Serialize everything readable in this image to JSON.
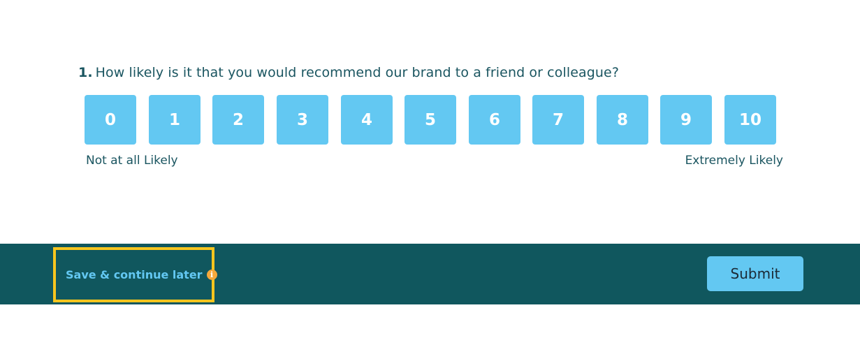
{
  "question": {
    "number": "1.",
    "text": "How likely is it that you would recommend our brand to a friend or colleague?"
  },
  "scale": {
    "options": [
      "0",
      "1",
      "2",
      "3",
      "4",
      "5",
      "6",
      "7",
      "8",
      "9",
      "10"
    ],
    "min_label": "Not at all Likely",
    "max_label": "Extremely Likely"
  },
  "footer": {
    "save_label": "Save & continue later",
    "info_icon": "info-icon",
    "info_glyph": "i",
    "submit_label": "Submit"
  },
  "colors": {
    "option_bg": "#63c8f2",
    "footer_bg": "#10575e",
    "highlight": "#f7c51e",
    "info_icon": "#f5a93c",
    "text": "#1a5560"
  }
}
